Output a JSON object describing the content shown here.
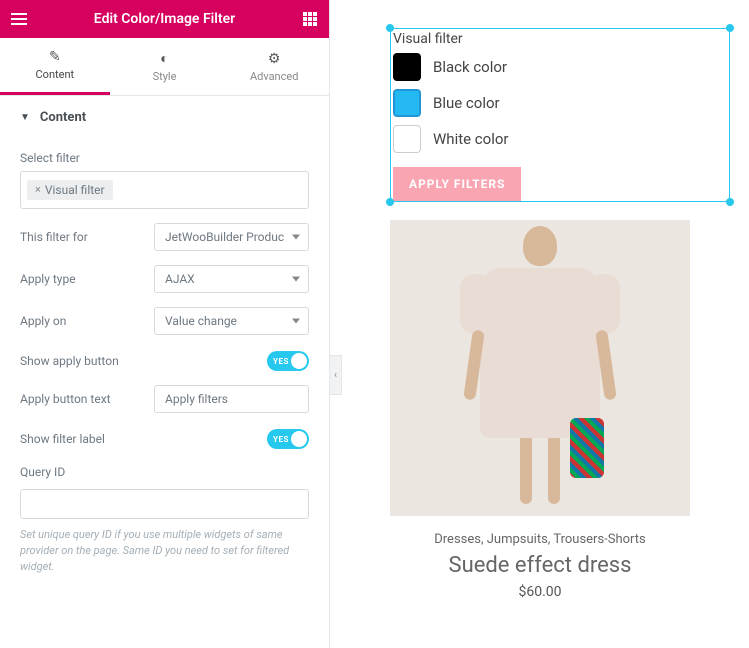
{
  "header": {
    "title": "Edit Color/Image Filter"
  },
  "tabs": {
    "content": "Content",
    "style": "Style",
    "advanced": "Advanced"
  },
  "section": {
    "title": "Content"
  },
  "fields": {
    "select_filter_label": "Select filter",
    "select_filter_tag": "Visual filter",
    "this_filter_for_label": "This filter for",
    "this_filter_for_value": "JetWooBuilder Produc",
    "apply_type_label": "Apply type",
    "apply_type_value": "AJAX",
    "apply_on_label": "Apply on",
    "apply_on_value": "Value change",
    "show_apply_button_label": "Show apply button",
    "apply_button_text_label": "Apply button text",
    "apply_button_text_value": "Apply filters",
    "show_filter_label_label": "Show filter label",
    "query_id_label": "Query ID",
    "query_id_help": "Set unique query ID if you use multiple widgets of same provider on the page. Same ID you need to set for filtered widget.",
    "toggle_yes": "YES"
  },
  "preview": {
    "widget_title": "Visual filter",
    "colors": [
      {
        "label": "Black color"
      },
      {
        "label": "Blue color"
      },
      {
        "label": "White color"
      }
    ],
    "apply_label": "APPLY FILTERS",
    "product": {
      "categories": "Dresses, Jumpsuits, Trousers-Shorts",
      "name": "Suede effect dress",
      "price": "$60.00"
    }
  }
}
